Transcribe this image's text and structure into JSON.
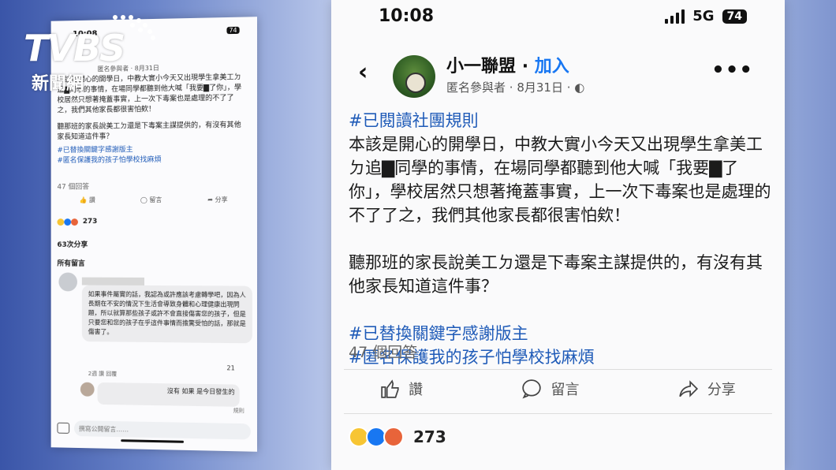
{
  "logo": {
    "brand": "TVBS",
    "sub": "新聞網"
  },
  "large": {
    "status": {
      "time": "10:08",
      "network": "5G",
      "battery": "74"
    },
    "group": {
      "name": "小一聯盟",
      "dot": "·",
      "join": "加入"
    },
    "meta": {
      "author": "匿名參與者",
      "date": "8月31日"
    },
    "post": {
      "rules_tag": "#已閱讀社團規則",
      "para1": "本該是開心的開學日，中教大實小今天又出現學生拿美工ㄉ追▇同學的事情，在場同學都聽到他大喊「我要▇了你」，學校居然只想著掩蓋事實，上一次下毒案也是處理的不了了之，我們其他家長都很害怕欸！",
      "para2": "聽那班的家長說美工ㄉ還是下毒案主謀提供的，有沒有其他家長知道這件事？",
      "tag1": "#已替換關鍵字感謝版主",
      "tag2": "#匿名保護我的孩子怕學校找麻煩"
    },
    "comments_count": "47 個回答",
    "actions": {
      "like": "讚",
      "comment": "留言",
      "share": "分享"
    },
    "reactions_count": "273",
    "colors": {
      "link": "#1877f2",
      "hashtag": "#1f5bb8"
    }
  },
  "small": {
    "status": {
      "time": "10:08",
      "battery": "74"
    },
    "meta": "匿名參與者 · 8月31日",
    "post": {
      "para1": "本該是開心的開學日，中教大實小今天又出現學生拿美工ㄉ追▇同學的事情，在場同學都聽到他大喊「我要▇了你」，學校居然只想著掩蓋事實，上一次下毒案也是處理的不了了之，我們其他家長都很害怕欸！",
      "para2": "聽那班的家長說美工ㄉ還是下毒案主謀提供的，有沒有其他家長知道這件事？",
      "tag1": "#已替換關鍵字感謝版主",
      "tag2": "#匿名保護我的孩子怕學校找麻煩"
    },
    "comments_count": "47 個回答",
    "actions": {
      "like": "讚",
      "comment": "留言",
      "share": "分享"
    },
    "reactions_count": "273",
    "shares": "63次分享",
    "all_comments": "所有留言",
    "comment1": {
      "text": "如果事件屬實的話，我認為或許應該考慮轉學吧，因為人長期在不安的情況下生活會導致身體和心理健康出現問題，所以就算那些孩子或許不會直接傷害您的孩子，但是只要您和您的孩子在乎這件事情而擔驚受怕的話，那就是傷害了。",
      "likes": "21",
      "meta": "2週  讚  回覆"
    },
    "comment2": {
      "text": "沒有 如果 是今日發生的"
    },
    "rules": "規則",
    "input_placeholder": "撰寫公開留言……"
  }
}
